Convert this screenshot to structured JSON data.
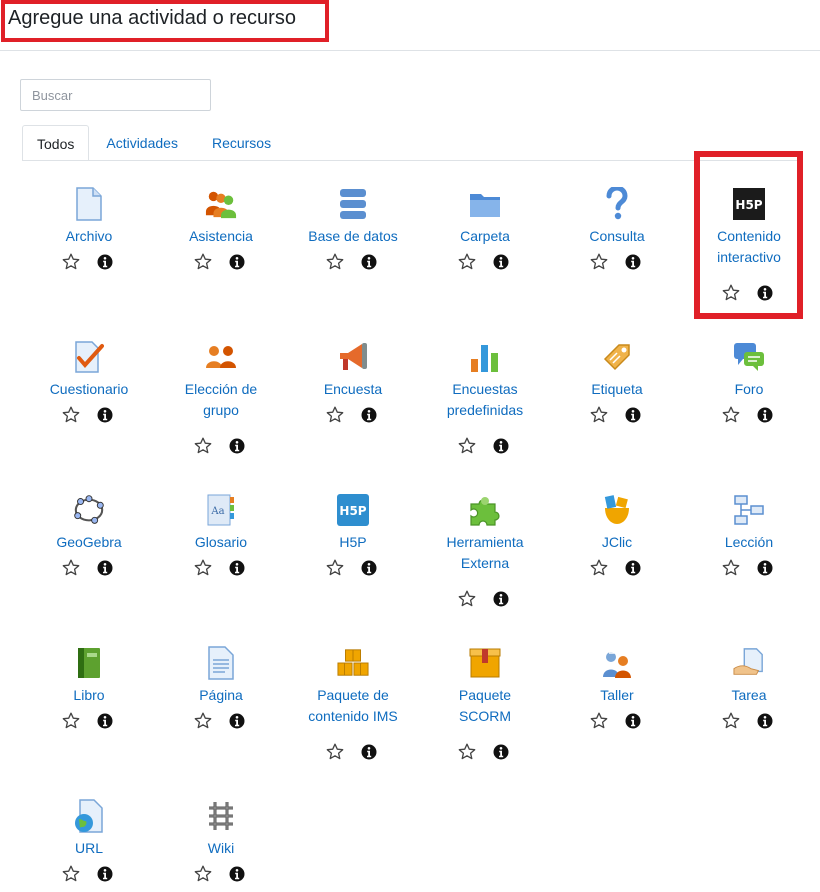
{
  "header": {
    "title": "Agregue una actividad o recurso"
  },
  "search": {
    "placeholder": "Buscar",
    "value": ""
  },
  "tabs": [
    {
      "label": "Todos",
      "active": true
    },
    {
      "label": "Actividades",
      "active": false
    },
    {
      "label": "Recursos",
      "active": false
    }
  ],
  "modules": [
    {
      "label": "Archivo",
      "icon": "file-icon"
    },
    {
      "label": "Asistencia",
      "icon": "attendance-icon"
    },
    {
      "label": "Base de datos",
      "icon": "database-icon"
    },
    {
      "label": "Carpeta",
      "icon": "folder-icon"
    },
    {
      "label": "Consulta",
      "icon": "question-icon"
    },
    {
      "label": "Contenido interactivo",
      "icon": "h5p-dark-icon"
    },
    {
      "label": "Cuestionario",
      "icon": "quiz-icon"
    },
    {
      "label": "Elección de grupo",
      "icon": "group-choice-icon"
    },
    {
      "label": "Encuesta",
      "icon": "megaphone-icon"
    },
    {
      "label": "Encuestas predefinidas",
      "icon": "bar-chart-icon"
    },
    {
      "label": "Etiqueta",
      "icon": "label-tag-icon"
    },
    {
      "label": "Foro",
      "icon": "forum-icon"
    },
    {
      "label": "GeoGebra",
      "icon": "geogebra-icon"
    },
    {
      "label": "Glosario",
      "icon": "glossary-icon"
    },
    {
      "label": "H5P",
      "icon": "h5p-blue-icon"
    },
    {
      "label": "Herramienta Externa",
      "icon": "puzzle-icon"
    },
    {
      "label": "JClic",
      "icon": "jclic-icon"
    },
    {
      "label": "Lección",
      "icon": "lesson-icon"
    },
    {
      "label": "Libro",
      "icon": "book-icon"
    },
    {
      "label": "Página",
      "icon": "page-icon"
    },
    {
      "label": "Paquete de contenido IMS",
      "icon": "ims-package-icon"
    },
    {
      "label": "Paquete SCORM",
      "icon": "scorm-package-icon"
    },
    {
      "label": "Taller",
      "icon": "workshop-icon"
    },
    {
      "label": "Tarea",
      "icon": "assignment-icon"
    },
    {
      "label": "URL",
      "icon": "url-globe-icon"
    },
    {
      "label": "Wiki",
      "icon": "wiki-icon"
    }
  ]
}
